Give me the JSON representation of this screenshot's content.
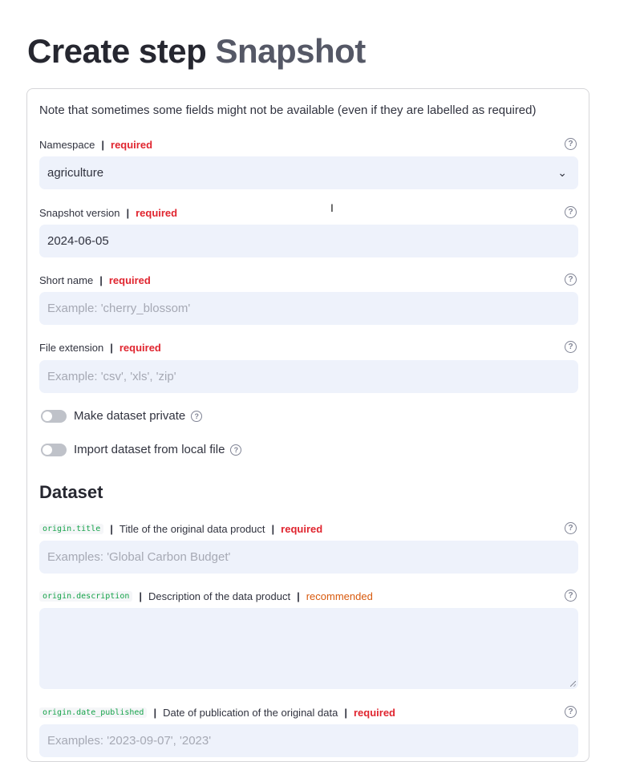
{
  "title": {
    "prefix": "Create step",
    "accent": "Snapshot"
  },
  "note": "Note that sometimes some fields might not be available (even if they are labelled as required)",
  "separator": "|",
  "help_glyph": "?",
  "fields": {
    "namespace": {
      "label": "Namespace",
      "tag": "required",
      "value": "agriculture",
      "chevron": "⌄",
      "icon": "chevron-down-icon"
    },
    "snapshot_version": {
      "label": "Snapshot version",
      "tag": "required",
      "value": "2024-06-05"
    },
    "short_name": {
      "label": "Short name",
      "tag": "required",
      "placeholder": "Example: 'cherry_blossom'"
    },
    "file_extension": {
      "label": "File extension",
      "tag": "required",
      "placeholder": "Example: 'csv', 'xls', 'zip'"
    }
  },
  "toggles": {
    "private": {
      "label": "Make dataset private",
      "on": false
    },
    "local_file": {
      "label": "Import dataset from local file",
      "on": false
    }
  },
  "section": {
    "title": "Dataset"
  },
  "dataset_fields": {
    "origin_title": {
      "code": "origin.title",
      "label": "Title of the original data product",
      "tag": "required",
      "placeholder": "Examples: 'Global Carbon Budget'"
    },
    "origin_description": {
      "code": "origin.description",
      "label": "Description of the data product",
      "tag": "recommended",
      "value": ""
    },
    "origin_date_published": {
      "code": "origin.date_published",
      "label": "Date of publication of the original data",
      "tag": "required",
      "placeholder": "Examples: '2023-09-07', '2023'"
    }
  },
  "colors": {
    "required": "#e0252f",
    "recommended": "#d8590c",
    "input_bg": "#eef2fb",
    "code": "#16a34a"
  }
}
